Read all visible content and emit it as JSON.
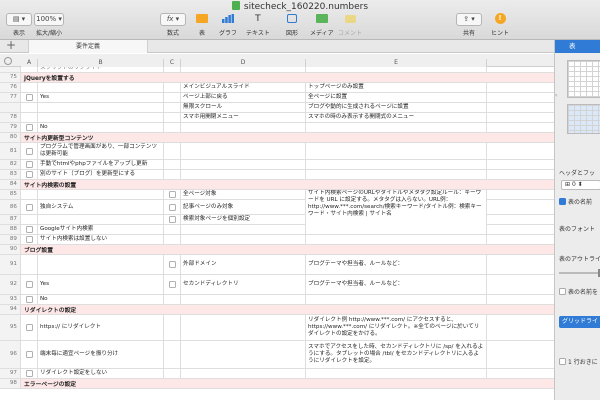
{
  "window": {
    "title": "sitecheck_160220.numbers"
  },
  "toolbar": {
    "items": [
      {
        "label": "表示",
        "icon": "view-icon"
      },
      {
        "label": "拡大/縮小",
        "value": "100%",
        "icon": "zoom-icon"
      },
      {
        "label": "数式",
        "icon": "function-icon",
        "glyph": "fx"
      },
      {
        "label": "表",
        "icon": "table-icon"
      },
      {
        "label": "グラフ",
        "icon": "chart-icon"
      },
      {
        "label": "テキスト",
        "icon": "text-icon",
        "glyph": "T"
      },
      {
        "label": "図形",
        "icon": "shape-icon"
      },
      {
        "label": "メディア",
        "icon": "media-icon"
      },
      {
        "label": "コメント",
        "icon": "comment-icon"
      },
      {
        "label": "共有",
        "icon": "share-icon"
      },
      {
        "label": "ヒント",
        "icon": "hint-icon",
        "glyph": "!"
      }
    ]
  },
  "tabs": {
    "add": "+",
    "active": "要件定義"
  },
  "columns": [
    "A",
    "B",
    "C",
    "D",
    "E"
  ],
  "top_partial_row": {
    "b": "スクリプトのリフライト"
  },
  "rows": [
    {
      "n": "75",
      "section": "jQueryを設置する"
    },
    {
      "n": "76",
      "d": "メインビジュアルスライド",
      "e": "トップページのみ設置"
    },
    {
      "n": "77",
      "b": "Yes",
      "check": true,
      "d": "ページ上部に戻る",
      "e": "全ページに設置"
    },
    {
      "n": "77b",
      "d": "無限スクロール",
      "e": "ブログや動的に生成されるページに設置"
    },
    {
      "n": "78",
      "d": "スマホ用開閉メニュー",
      "e": "スマホの時のみ表示する開閉式のメニュー"
    },
    {
      "n": "79",
      "b": "No",
      "check": true
    },
    {
      "n": "80",
      "section": "サイト内更新型コンテンツ"
    },
    {
      "n": "81",
      "b": "プログラムで管理画面があり、一部コンテンツは更新可能",
      "check": true
    },
    {
      "n": "82",
      "b": "手動でhtmlやphpファイルをアップし更新",
      "check": true
    },
    {
      "n": "83",
      "b": "別のサイト（ブログ）を更新型にする",
      "check": true
    },
    {
      "n": "84",
      "section": "サイト内検索の設置"
    },
    {
      "n": "85",
      "d": "全ページ対象",
      "check_d": true,
      "e": "サイト内検索ページのURLやタイトルやメタタグ設定ルール：キーワードを URL に設定する。メタタグは入らない。URL例：http://www.***.com/search/検索キーワード/タイトル例：検索キーワード・サイト内検索 | サイト名"
    },
    {
      "n": "86",
      "b": "独自システム",
      "check": true,
      "d": "記事ページのみ対象",
      "check_d": true
    },
    {
      "n": "87",
      "d": "検索対象ページを個別設定",
      "check_d": true
    },
    {
      "n": "88",
      "b": "Googleサイト内検索",
      "check": true
    },
    {
      "n": "89",
      "b": "サイト内検索は設置しない",
      "check": true
    },
    {
      "n": "90",
      "section": "ブログ設置"
    },
    {
      "n": "91",
      "d": "外部ドメイン",
      "check_d": true,
      "e": "ブログテーマや担当者、ルールなど："
    },
    {
      "n": "92",
      "b": "Yes",
      "check": true,
      "d": "セカンドディレクトリ",
      "check_d": true,
      "e": "ブログテーマや担当者、ルールなど："
    },
    {
      "n": "93",
      "b": "No",
      "check": true
    },
    {
      "n": "94",
      "section": "リダイレクトの設定"
    },
    {
      "n": "95",
      "b": "https:// にリダイレクト",
      "check": true,
      "e": "リダイレクト例 http://www.***.com/ にアクセスすると、https://www.***.com/ にリダイレクト。※全てのページに於いてリダイレクトの設定をかける。"
    },
    {
      "n": "96",
      "b": "端末毎に適宜ページを振り分け",
      "check": true,
      "e": "スマホでアクセスをした時、セカンドディレクトリに /sp/ を入れるようにする。タブレットの場合 /tbl/ をセカンドディレクトリに入るようにリダイレクトを設定。"
    },
    {
      "n": "97",
      "b": "リダイレクト設定をしない",
      "check": true
    },
    {
      "n": "98",
      "section": "エラーページの設定"
    }
  ],
  "panel": {
    "tab": "表",
    "header_footer": "ヘッダとフッ",
    "header_count": "0",
    "table_name_checkbox": "表の名前",
    "table_font": "表のフォント",
    "table_outline": "表のアウトライ",
    "table_name_outline": "表の名前を",
    "gridlines": "グリッドライ",
    "alternate_rows": "1 行おきに"
  }
}
